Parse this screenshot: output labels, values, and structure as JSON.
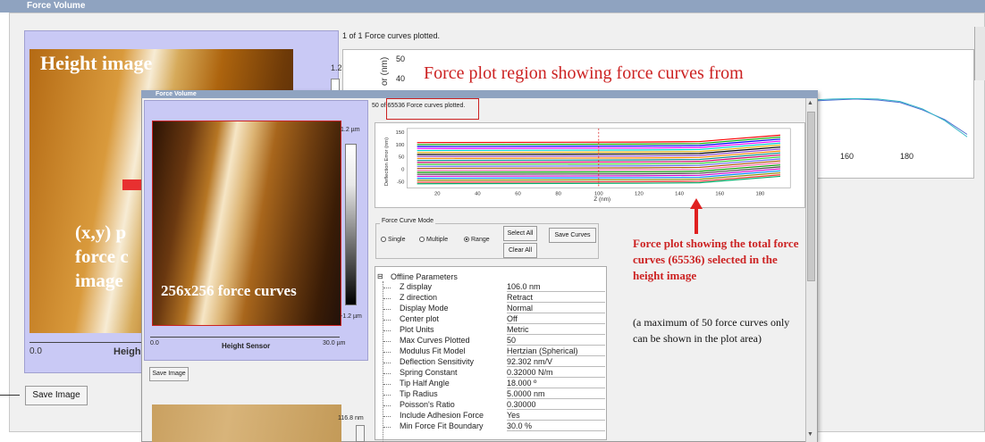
{
  "back_window": {
    "title": "Force Volume",
    "status": "1 of 1 Force curves plotted.",
    "image_title": "Height image",
    "scale_top": "1.2 µm",
    "annotation_xy": "(x,y) p force c image",
    "axis_zero": "0.0",
    "axis_name": "Heigh",
    "save_image": "Save Image",
    "plot_heading": "Force plot region showing force curves from",
    "plot_ylabel": "or (nm)",
    "y_ticks": [
      "50",
      "40"
    ],
    "x_ticks": [
      "160",
      "180"
    ]
  },
  "front_window": {
    "title": "Force Volume",
    "status": "50 of 65536 Force curves plotted.",
    "image_label": "256x256 force curves",
    "scale_top": "1.2 µm",
    "scale_bottom": "-1.2 µm",
    "axis_zero": "0.0",
    "axis_name": "Height Sensor",
    "axis_end": "30.0 µm",
    "save_image": "Save Image",
    "scale2_top": "116.8 nm",
    "force_curve_mode": {
      "label": "Force Curve Mode",
      "options": [
        "Single",
        "Multiple",
        "Range"
      ],
      "selected": "Range",
      "select_all": "Select All",
      "clear_all": "Clear All",
      "save_curves": "Save Curves"
    },
    "params": {
      "title": "Offline Parameters",
      "expander": "⊟",
      "rows": [
        {
          "name": "Z display",
          "value": "106.0 nm"
        },
        {
          "name": "Z direction",
          "value": "Retract"
        },
        {
          "name": "Display Mode",
          "value": "Normal"
        },
        {
          "name": "Center plot",
          "value": "Off"
        },
        {
          "name": "Plot Units",
          "value": "Metric"
        },
        {
          "name": "Max Curves Plotted",
          "value": "50"
        },
        {
          "name": "Modulus Fit Model",
          "value": "Hertzian (Spherical)"
        },
        {
          "name": "Deflection Sensitivity",
          "value": "92.302 nm/V"
        },
        {
          "name": "Spring Constant",
          "value": "0.32000 N/m"
        },
        {
          "name": "Tip Half Angle",
          "value": "18.000 º"
        },
        {
          "name": "Tip Radius",
          "value": "5.0000 nm"
        },
        {
          "name": "Poisson's Ratio",
          "value": "0.30000"
        },
        {
          "name": "Include Adhesion Force",
          "value": "Yes"
        },
        {
          "name": "Min Force Fit Boundary",
          "value": "30.0 %"
        }
      ]
    }
  },
  "annotations": {
    "red": "Force plot showing the total force curves (65536) selected in the height  image",
    "black": "(a maximum of 50 force curves only can be shown in the plot area)"
  },
  "chart_data": {
    "type": "line",
    "title": "",
    "xlabel": "Z (nm)",
    "ylabel": "Deflection Error (nm)",
    "x_ticks": [
      20,
      40,
      60,
      80,
      100,
      120,
      140,
      160,
      180
    ],
    "y_ticks": [
      150,
      100,
      50,
      0,
      -50
    ],
    "xlim": [
      5,
      195
    ],
    "ylim": [
      -75,
      165
    ],
    "marker_x": 100,
    "curve_count": 50,
    "x": [
      10,
      120,
      150,
      165,
      190
    ],
    "series": [
      {
        "values": [
          108,
          110,
          112,
          122,
          138
        ]
      },
      {
        "values": [
          100,
          102,
          104,
          114,
          130
        ]
      },
      {
        "values": [
          92,
          94,
          96,
          106,
          122
        ]
      },
      {
        "values": [
          84,
          86,
          88,
          98,
          114
        ]
      },
      {
        "values": [
          76,
          78,
          80,
          90,
          106
        ]
      },
      {
        "values": [
          68,
          70,
          72,
          82,
          98
        ]
      },
      {
        "values": [
          60,
          62,
          64,
          74,
          90
        ]
      },
      {
        "values": [
          52,
          54,
          56,
          66,
          82
        ]
      },
      {
        "values": [
          44,
          46,
          48,
          58,
          74
        ]
      },
      {
        "values": [
          36,
          38,
          40,
          50,
          66
        ]
      },
      {
        "values": [
          28,
          30,
          32,
          42,
          58
        ]
      },
      {
        "values": [
          20,
          22,
          24,
          34,
          50
        ]
      },
      {
        "values": [
          12,
          14,
          16,
          26,
          42
        ]
      },
      {
        "values": [
          4,
          6,
          8,
          18,
          34
        ]
      },
      {
        "values": [
          -4,
          -2,
          0,
          10,
          26
        ]
      },
      {
        "values": [
          -12,
          -10,
          -8,
          2,
          18
        ]
      },
      {
        "values": [
          -20,
          -18,
          -16,
          -6,
          10
        ]
      },
      {
        "values": [
          -28,
          -26,
          -24,
          -14,
          2
        ]
      },
      {
        "values": [
          -36,
          -34,
          -32,
          -22,
          -6
        ]
      },
      {
        "values": [
          -44,
          -42,
          -40,
          -30,
          -14
        ]
      },
      {
        "values": [
          -52,
          -50,
          -48,
          -38,
          -22
        ]
      },
      {
        "values": [
          -58,
          -56,
          -54,
          -44,
          -28
        ]
      }
    ],
    "colors": [
      "#ff0000",
      "#00aa00",
      "#0000ff",
      "#ff00ff",
      "#00cccc",
      "#ddaa00",
      "#000000",
      "#8844cc",
      "#ff8800",
      "#008888",
      "#cc0066",
      "#33cc33",
      "#6666ff",
      "#aa5500",
      "#ff66aa",
      "#009900",
      "#444444",
      "#cc00cc",
      "#0088ff",
      "#888800",
      "#ff3333",
      "#00aa66"
    ]
  },
  "back_chart": {
    "type": "line",
    "series": [
      {
        "values": [
          58,
          60,
          62,
          60,
          55,
          40,
          20,
          -10
        ]
      },
      {
        "values": [
          60,
          62,
          63,
          62,
          57,
          42,
          18,
          -15
        ]
      }
    ],
    "colors": [
      "#4b6fd0",
      "#38b8c8"
    ]
  }
}
